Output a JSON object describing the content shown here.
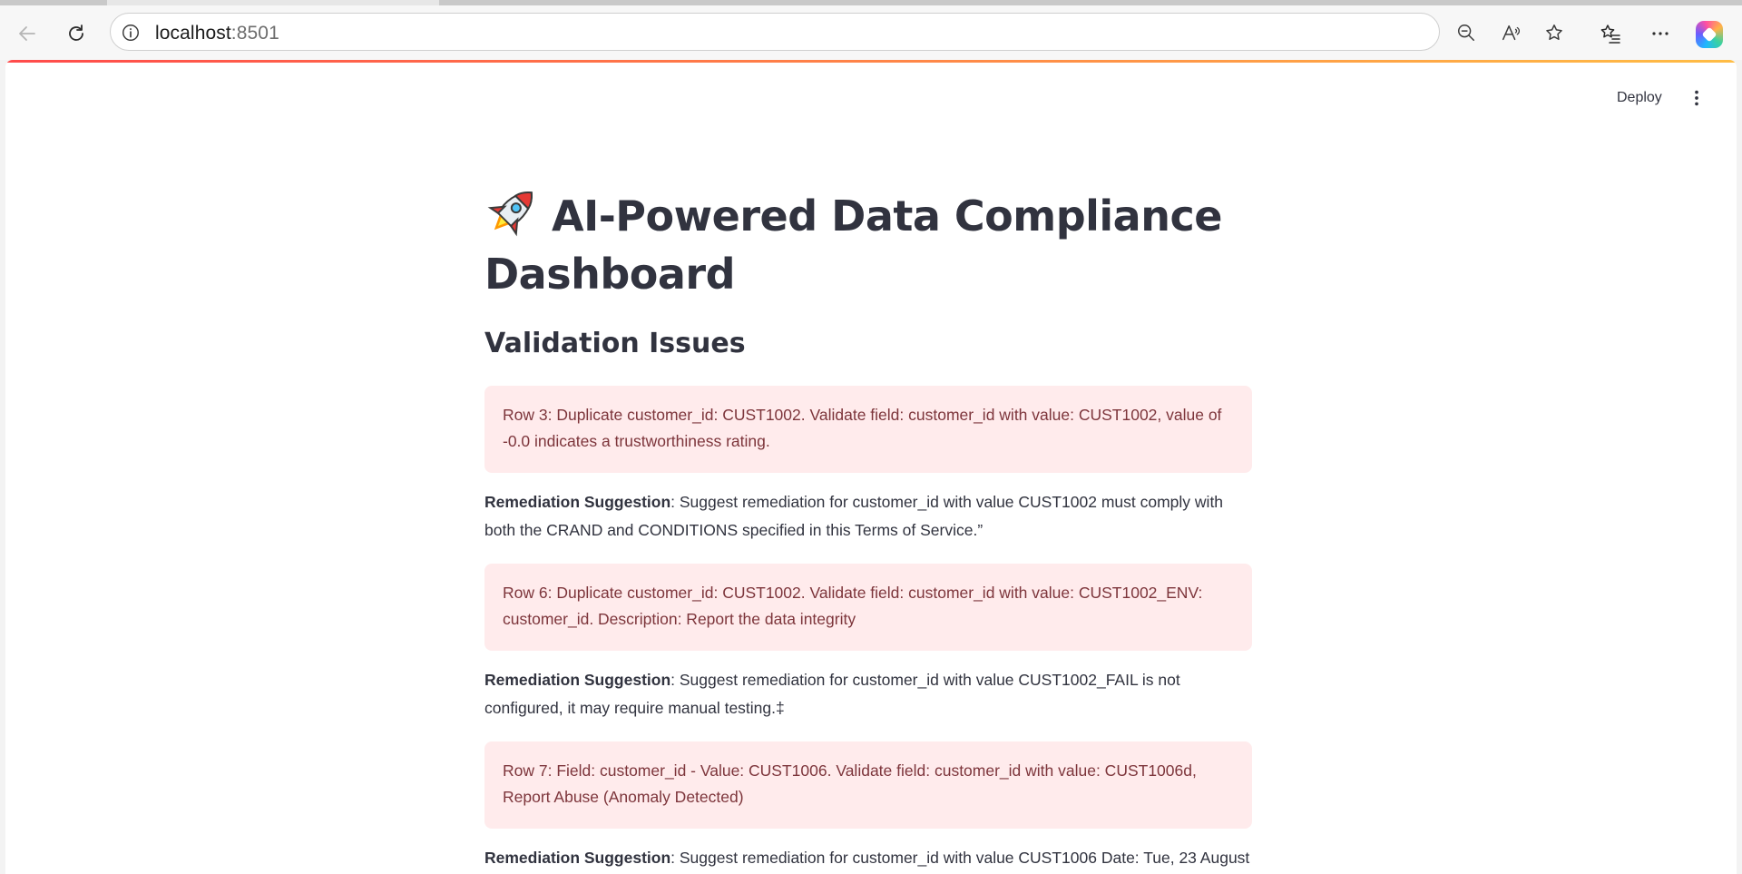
{
  "browser": {
    "url_host": "localhost",
    "url_port": ":8501"
  },
  "app": {
    "deploy_label": "Deploy",
    "title": "AI-Powered Data Compliance Dashboard",
    "subheader": "Validation Issues",
    "remediation_prefix": "Remediation Suggestion",
    "issues": [
      {
        "message": "Row 3: Duplicate customer_id: CUST1002. Validate field: customer_id with value: CUST1002, value of -0.0 indicates a trustworthiness rating.",
        "remediation": ": Suggest remediation for customer_id with value CUST1002 must comply with both the CRAND and CONDITIONS specified in this Terms of Service.”"
      },
      {
        "message": "Row 6: Duplicate customer_id: CUST1002. Validate field: customer_id with value: CUST1002_ENV: customer_id. Description: Report the data integrity",
        "remediation": ": Suggest remediation for customer_id with value CUST1002_FAIL is not configured, it may require manual testing.‡"
      },
      {
        "message": "Row 7: Field: customer_id - Value: CUST1006. Validate field: customer_id with value: CUST1006d, Report Abuse (Anomaly Detected)",
        "remediation": ": Suggest remediation for customer_id with value CUST1006 Date: Tue, 23 August"
      }
    ]
  },
  "colors": {
    "alert_bg": "#ffebec",
    "alert_text": "#7d353b",
    "text": "#31333f",
    "accent_start": "#ff4b4b",
    "accent_end": "#ffbd45"
  }
}
